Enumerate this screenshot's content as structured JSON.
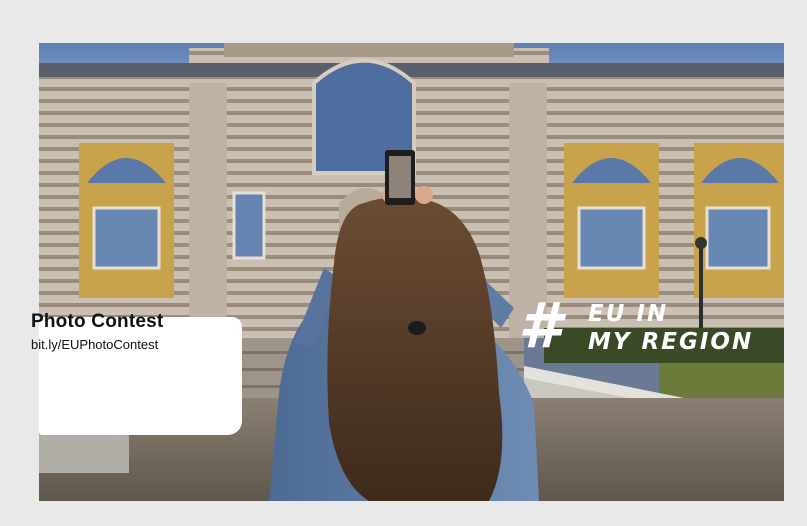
{
  "image": {
    "subject": "woman-photographing-building-with-phone",
    "colors": {
      "background": "#e9e9e9",
      "card": "#ffffff",
      "overlay_text": "#ffffff"
    }
  },
  "promo": {
    "title": "Photo Contest",
    "link": "bit.ly/EUPhotoContest"
  },
  "campaign": {
    "hashtag": "#",
    "line1": "EU IN",
    "line2": "MY REGION"
  }
}
